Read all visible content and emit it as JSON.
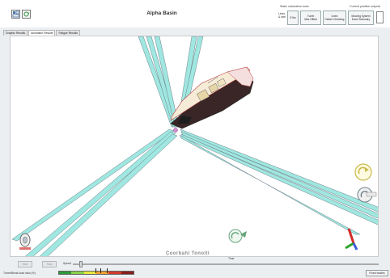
{
  "app": {
    "title": "Alpha Basin"
  },
  "header": {
    "static_group_label": "Static calculation tools",
    "position_group_label": "Current position outputs",
    "lines_rate_label": "Lines\n& rate",
    "buttons": [
      {
        "id": "5m-button",
        "label": "5·5m"
      },
      {
        "id": "turret-max-offset",
        "label": "Turret\nMax Offset"
      },
      {
        "id": "lines-failure-checking",
        "label": "Lines\nFailure Checking"
      },
      {
        "id": "mooring-system-excel-summary",
        "label": "Mooring System\nExcel Summary"
      }
    ]
  },
  "tabs": [
    {
      "label": "Graphic Results",
      "active": false
    },
    {
      "label": "Animation Results",
      "active": true
    },
    {
      "label": "Fatigue Results",
      "active": false
    }
  ],
  "viewport": {
    "watermark": "Coorbahl Tonoiti",
    "line_color": "#9fe7e0",
    "line_edge_color": "#6c7f89",
    "hull_color": "#f4e6e6",
    "deck_color": "#f3edc8"
  },
  "controls": {
    "start_label": "Start",
    "stop_label": "Stop",
    "speed_label": "Speed",
    "time_label": "Time",
    "speed_value_fraction": 0.02
  },
  "load_bar": {
    "label": "Turret/Break load ratio (%)",
    "segments": [
      "#2c9b3a",
      "#8bd14a",
      "#e8e63a",
      "#f0a030",
      "#d33a2c",
      "#8a1e1e"
    ]
  },
  "fixed_button_label": "Fixed bodies"
}
